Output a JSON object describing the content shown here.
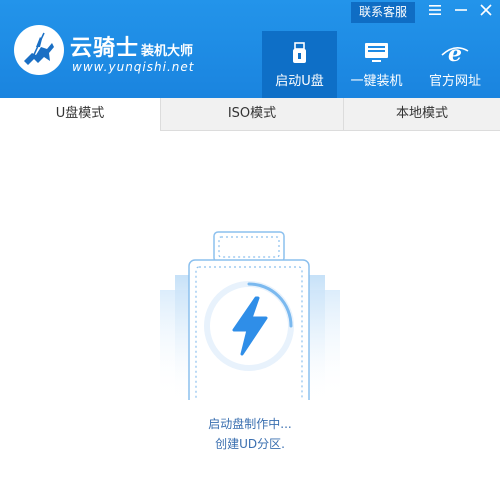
{
  "app": {
    "brand_name": "云骑士",
    "brand_sub": "装机大师",
    "url": "www.yunqishi.net",
    "contact_label": "联系客服"
  },
  "window_controls": {
    "menu_icon": "menu-icon",
    "minimize_icon": "minimize-icon",
    "close_icon": "close-icon"
  },
  "nav": {
    "items": [
      {
        "label": "启动U盘",
        "icon": "usb-icon",
        "active": true
      },
      {
        "label": "一键装机",
        "icon": "monitor-icon",
        "active": false
      },
      {
        "label": "官方网址",
        "icon": "browser-e-icon",
        "active": false
      }
    ]
  },
  "tabs": [
    {
      "label": "U盘模式",
      "active": true
    },
    {
      "label": "ISO模式",
      "active": false
    },
    {
      "label": "本地模式",
      "active": false
    }
  ],
  "progress": {
    "line1": "启动盘制作中...",
    "line2": "创建UD分区."
  },
  "colors": {
    "header": "#1e8ae4",
    "active_nav": "#0e6fc7",
    "status_text": "#3a6fb0",
    "bolt": "#2f8ee8"
  }
}
